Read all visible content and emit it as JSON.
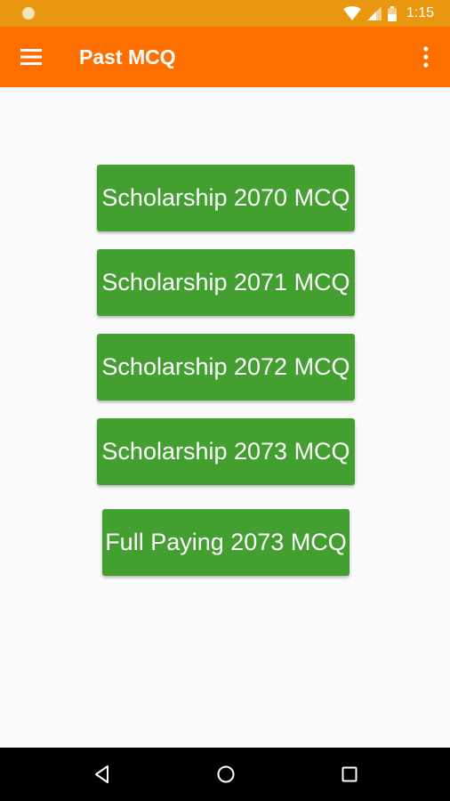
{
  "status_bar": {
    "time": "1:15",
    "icons": [
      "notification-dot-icon",
      "wifi-icon",
      "signal-icon",
      "battery-icon"
    ]
  },
  "app_bar": {
    "title": "Past MCQ",
    "menu_icon": "hamburger-menu-icon",
    "overflow_icon": "more-vert-icon",
    "color": "#ff6f00"
  },
  "buttons": [
    {
      "label": "Scholarship 2070 MCQ"
    },
    {
      "label": "Scholarship 2071 MCQ"
    },
    {
      "label": "Scholarship 2072 MCQ"
    },
    {
      "label": "Scholarship 2073 MCQ"
    },
    {
      "label": "Full Paying 2073 MCQ"
    }
  ],
  "button_color": "#43a030",
  "nav_bar": {
    "icons": [
      "back-icon",
      "home-icon",
      "recents-icon"
    ]
  }
}
